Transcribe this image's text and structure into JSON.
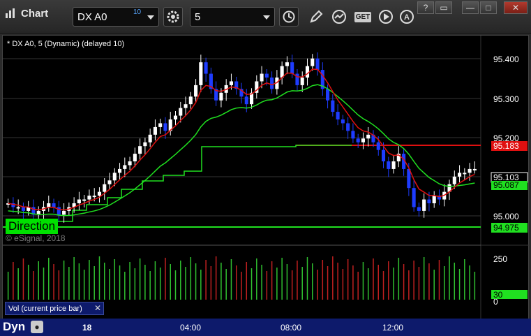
{
  "window": {
    "title": "Chart"
  },
  "toolbar": {
    "symbol": "DX A0",
    "symbol_badge": "10",
    "interval": "5",
    "buttons": [
      "settings-icon",
      "clock-icon",
      "pencil-icon",
      "study-icon",
      "get-icon",
      "play-icon",
      "annotate-icon"
    ],
    "get_label": "GET",
    "window_buttons": [
      "?",
      "▭",
      "—",
      "□",
      "✕"
    ]
  },
  "chart": {
    "header": "* DX A0, 5 (Dynamic) (delayed 10)",
    "copyright": "© eSignal, 2018",
    "direction_label": "Direction",
    "price_ticks": [
      "95.400",
      "95.300",
      "95.200",
      "95.000"
    ],
    "price_labels": {
      "red_level": "95.183",
      "last": "95.103",
      "green_ma": "95.087",
      "green_level": "94.975"
    },
    "volume_ticks": [
      "250",
      "0"
    ],
    "volume_label": "30",
    "volume_header": "Vol (current price bar)",
    "volume_close": "✕",
    "x_ticks": [
      "18",
      "04:00",
      "08:00",
      "12:00"
    ],
    "dyn_label": "Dyn"
  },
  "chart_data": {
    "type": "candlestick",
    "ylim": [
      94.9,
      95.45
    ],
    "levels": [
      {
        "name": "red",
        "value": 95.183,
        "color": "#e01010"
      },
      {
        "name": "green",
        "value": 94.975,
        "color": "#20e020"
      }
    ],
    "closes": [
      95.01,
      95.0,
      95.0,
      94.99,
      95.0,
      94.98,
      94.99,
      95.0,
      95.01,
      95.0,
      94.98,
      94.99,
      95.0,
      95.01,
      95.02,
      95.02,
      95.03,
      95.03,
      95.04,
      95.06,
      95.07,
      95.09,
      95.1,
      95.11,
      95.12,
      95.14,
      95.16,
      95.17,
      95.19,
      95.21,
      95.22,
      95.2,
      95.23,
      95.24,
      95.26,
      95.27,
      95.29,
      95.32,
      95.38,
      95.35,
      95.31,
      95.28,
      95.3,
      95.32,
      95.33,
      95.31,
      95.29,
      95.27,
      95.3,
      95.33,
      95.35,
      95.34,
      95.31,
      95.34,
      95.37,
      95.38,
      95.35,
      95.32,
      95.34,
      95.37,
      95.39,
      95.36,
      95.31,
      95.28,
      95.25,
      95.23,
      95.22,
      95.2,
      95.18,
      95.17,
      95.18,
      95.19,
      95.17,
      95.15,
      95.12,
      95.1,
      95.12,
      95.14,
      95.1,
      95.05,
      95.0,
      94.99,
      95.02,
      95.01,
      95.03,
      95.02,
      95.04,
      95.06,
      95.08,
      95.09,
      95.09,
      95.1,
      95.1
    ]
  },
  "colors": {
    "bg": "#000000",
    "up_candle": "#ffffff",
    "down_candle": "#1e3cff",
    "ma_red": "#e01010",
    "ma_green": "#20e020",
    "axis_panel": "#0d1a6b"
  }
}
